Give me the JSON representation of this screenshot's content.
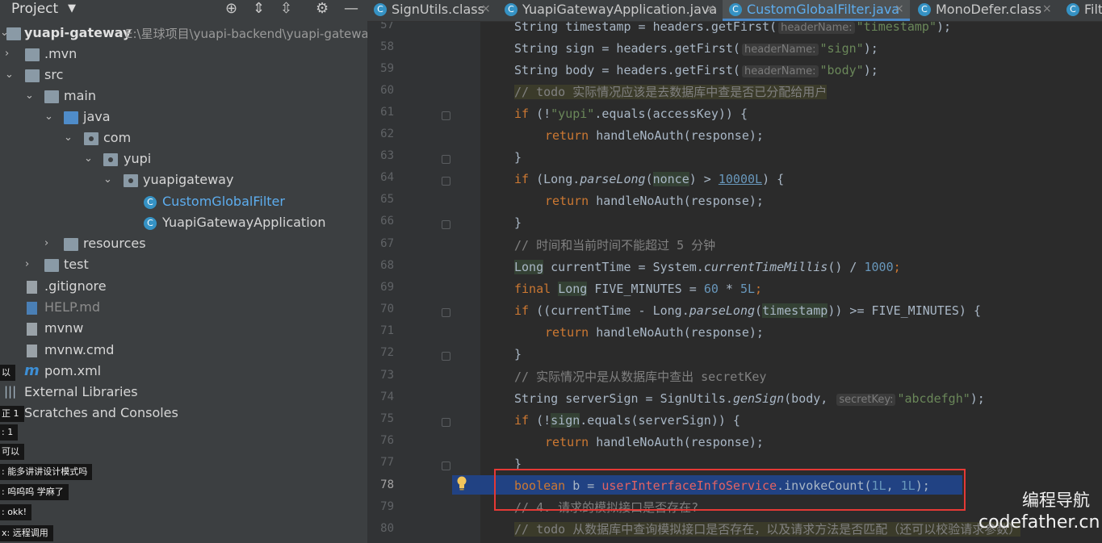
{
  "project_panel": {
    "title": "Project",
    "root": {
      "name": "yuapi-gateway",
      "path": "E:\\星球项目\\yuapi-backend\\yuapi-gatewa"
    },
    "tree": [
      {
        "label": ".mvn"
      },
      {
        "label": "src"
      },
      {
        "label": "main"
      },
      {
        "label": "java"
      },
      {
        "label": "com"
      },
      {
        "label": "yupi"
      },
      {
        "label": "yuapigateway"
      },
      {
        "label": "CustomGlobalFilter"
      },
      {
        "label": "YuapiGatewayApplication"
      },
      {
        "label": "resources"
      },
      {
        "label": "test"
      },
      {
        "label": ".gitignore"
      },
      {
        "label": "HELP.md"
      },
      {
        "label": "mvnw"
      },
      {
        "label": "mvnw.cmd"
      },
      {
        "label": "pom.xml"
      },
      {
        "label": "External Libraries"
      },
      {
        "label": "Scratches and Consoles"
      }
    ]
  },
  "chat_overlay": [
    {
      "text": "以"
    },
    {
      "text": "正 1"
    },
    {
      "text": ": 1"
    },
    {
      "text": "可以"
    },
    {
      "text": ": 能多讲讲设计模式吗"
    },
    {
      "text": ": 呜呜呜 学麻了"
    },
    {
      "text": ": okk!"
    },
    {
      "text": "x: 远程调用"
    }
  ],
  "tabs": [
    {
      "label": "SignUtils.class",
      "close": "×"
    },
    {
      "label": "YuapiGatewayApplication.java",
      "close": "×"
    },
    {
      "label": "CustomGlobalFilter.java",
      "close": "×",
      "active": true
    },
    {
      "label": "MonoDefer.class",
      "close": "×"
    },
    {
      "label": "Filte",
      "close": ""
    }
  ],
  "editor": {
    "line_numbers": [
      "57",
      "58",
      "59",
      "60",
      "61",
      "62",
      "63",
      "64",
      "65",
      "66",
      "67",
      "68",
      "69",
      "70",
      "71",
      "72",
      "73",
      "74",
      "75",
      "76",
      "77",
      "78",
      "79",
      "80"
    ],
    "lines": {
      "l57a": "String timestamp = headers.getFirst(",
      "l57h": "headerName:",
      "l57s": "\"timestamp\"",
      "l57e": ");",
      "l58a": "String sign = headers.getFirst(",
      "l58h": "headerName:",
      "l58s": "\"sign\"",
      "l58e": ");",
      "l59a": "String body = headers.getFirst(",
      "l59h": "headerName:",
      "l59s": "\"body\"",
      "l59e": ");",
      "l60": "// todo 实际情况应该是去数据库中查是否已分配给用户",
      "l61a": "if",
      "l61b": " (!",
      "l61s": "\"yupi\"",
      "l61c": ".equals(accessKey)) {",
      "l62a": "return",
      "l62b": " handleNoAuth(response);",
      "l63": "}",
      "l64a": "if",
      "l64b": " (Long.",
      "l64c": "parseLong",
      "l64d": "(",
      "l64e": "nonce",
      "l64f": ") > ",
      "l64n": "10000L",
      "l64g": ") {",
      "l65a": "return",
      "l65b": " handleNoAuth(response);",
      "l66": "}",
      "l67": "// 时间和当前时间不能超过 5 分钟",
      "l68a": "Long",
      "l68b": " currentTime = System.",
      "l68c": "currentTimeMillis",
      "l68d": "() / ",
      "l68n": "1000",
      "l68e": ";",
      "l69a": "final",
      "l69b": " ",
      "l69c": "Long",
      "l69d": " FIVE_MINUTES = ",
      "l69n": "60",
      "l69e": " * ",
      "l69n2": "5L",
      "l69f": ";",
      "l70a": "if",
      "l70b": " ((currentTime - Long.",
      "l70c": "parseLong",
      "l70d": "(",
      "l70e": "timestamp",
      "l70f": ")) >= FIVE_MINUTES) {",
      "l71a": "return",
      "l71b": " handleNoAuth(response);",
      "l72": "}",
      "l73": "// 实际情况中是从数据库中查出 secretKey",
      "l74a": "String serverSign = SignUtils.",
      "l74b": "genSign",
      "l74c": "(body, ",
      "l74h": "secretKey:",
      "l74s": "\"abcdefgh\"",
      "l74e": ");",
      "l75a": "if",
      "l75b": " (!",
      "l75c": "sign",
      "l75d": ".equals(serverSign)) {",
      "l76a": "return",
      "l76b": " handleNoAuth(response);",
      "l77": "}",
      "l78a": "boolean",
      "l78b": " b = ",
      "l78c": "userInterfaceInfoService",
      "l78d": ".invokeCount(",
      "l78n": "1L",
      "l78e": ", ",
      "l78n2": "1L",
      "l78f": ");",
      "l79": "// 4. 请求的模拟接口是否存在?",
      "l80": "// todo 从数据库中查询模拟接口是否存在，以及请求方法是否匹配（还可以校验请求参数）"
    }
  },
  "watermark": {
    "line1": "编程导航",
    "line2": "codefather.cn"
  },
  "colors": {
    "accent": "#4a88c7",
    "highlight_box": "#e53935",
    "selection": "#214283"
  }
}
